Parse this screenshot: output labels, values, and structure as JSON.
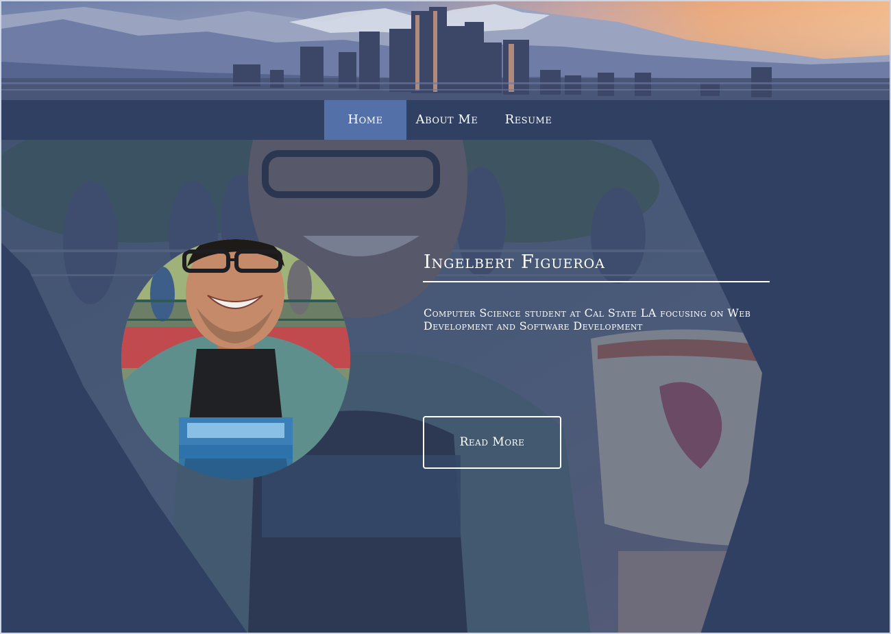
{
  "nav": {
    "items": [
      {
        "label": "Home",
        "active": true
      },
      {
        "label": "About Me",
        "active": false
      },
      {
        "label": "Resume",
        "active": false
      }
    ]
  },
  "hero": {
    "name": "Ingelbert Figueroa",
    "tagline": "Computer Science student at Cal State LA focusing on Web Development and Software Development",
    "cta_label": "Read More"
  },
  "colors": {
    "page_background": "#2c3e63",
    "navbar": "#2f4063",
    "nav_active": "#5470a8",
    "text": "#ffffff"
  },
  "images": {
    "banner": "city-skyline-at-sunset-with-mountains",
    "hero_background": "smiling-man-in-glasses-on-teacup-ride-tinted",
    "avatar": "profile-photo-smiling-man-in-glasses"
  }
}
